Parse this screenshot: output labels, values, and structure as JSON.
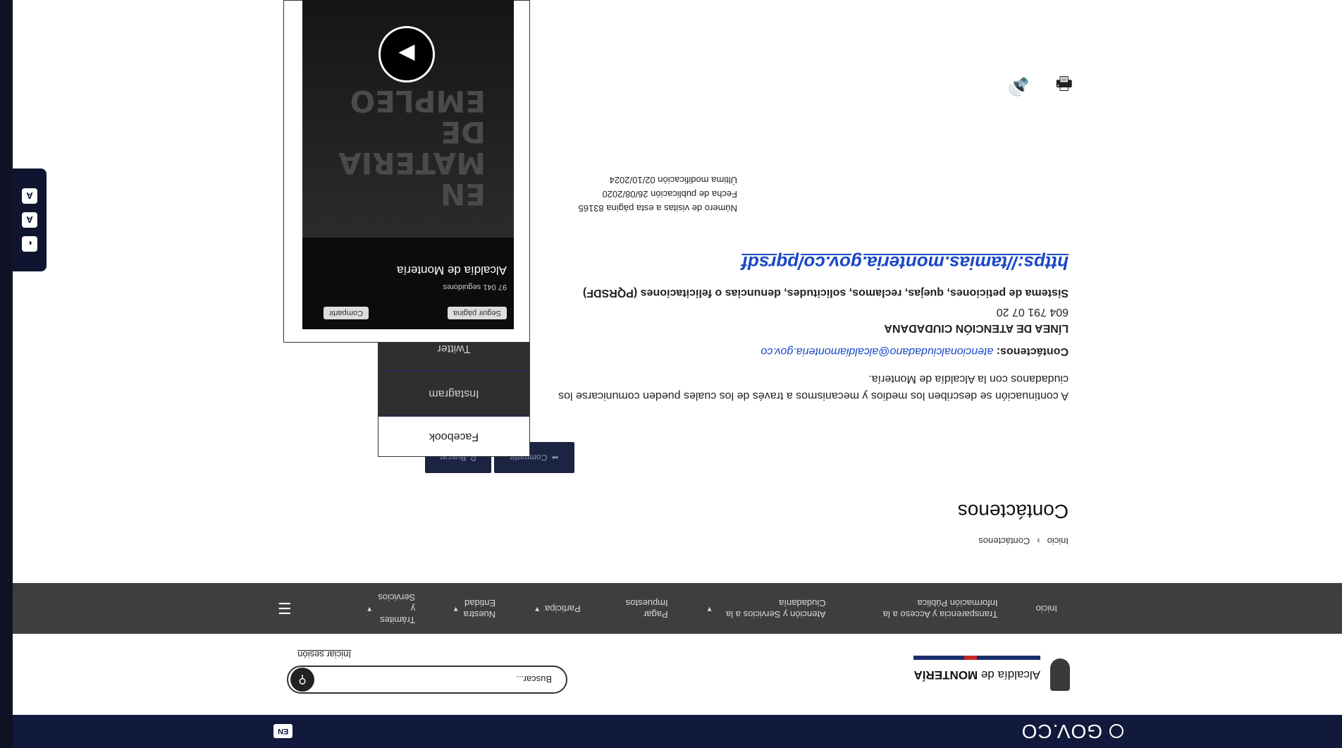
{
  "gov_bar": {
    "logo": "GOV.CO",
    "lang": "EN"
  },
  "header": {
    "brand_prefix": "Alcaldía de",
    "brand_name": "MONTERÍA",
    "search_placeholder": "Buscar...",
    "login": "Iniciar sesión"
  },
  "nav": {
    "items": [
      {
        "label": "Inicio"
      },
      {
        "label": "Transparencia y Acceso a la Información Pública"
      },
      {
        "label": "Atención y Servicios a la Ciudadanía"
      },
      {
        "label": "Pagar Impuestos"
      },
      {
        "label": "Participa"
      },
      {
        "label": "Nuestra Entidad"
      },
      {
        "label": "Trámites y Servicios"
      }
    ]
  },
  "breadcrumb": {
    "home": "Inicio",
    "current": "Contáctenos"
  },
  "page": {
    "title": "Contáctenos",
    "share": "Compartir",
    "search": "Buscar",
    "description": "A continuación se describen los medios y mecanismos a través de los cuales pueden comunicarse los ciudadanos con la Alcaldía de Montería.",
    "contact_label": "Contáctenos:",
    "email": "atencionalciudadano@alcaldiamonteria.gov.co",
    "line_title": "LÍNEA DE ATENCIÓN CIUDADANA",
    "phone": "604 791 07 20",
    "pqrsdf_title": "Sistema de peticiones, quejas, reclamos, solicitudes, denuncias o felicitaciones (PQRSDF)",
    "pqrsdf_url": "https://tamias.monteria.gov.co/pqrsdf"
  },
  "meta": {
    "visits": "Número de visitas a esta página 83165",
    "published": "Fecha de publicación 26/08/2020",
    "modified": "Última modificación 02/10/2024"
  },
  "social": {
    "tabs": [
      "Facebook",
      "Instagram",
      "Twitter"
    ],
    "fb_page": "Alcaldía de Montería",
    "fb_followers": "97 041 seguidores",
    "fb_follow": "Seguir página",
    "fb_share": "Compartir",
    "poster_text": "EN MATERIA DE EMPLEO"
  },
  "a11y": {
    "contrast": "◐",
    "font_smaller": "A",
    "font_larger": "A"
  }
}
